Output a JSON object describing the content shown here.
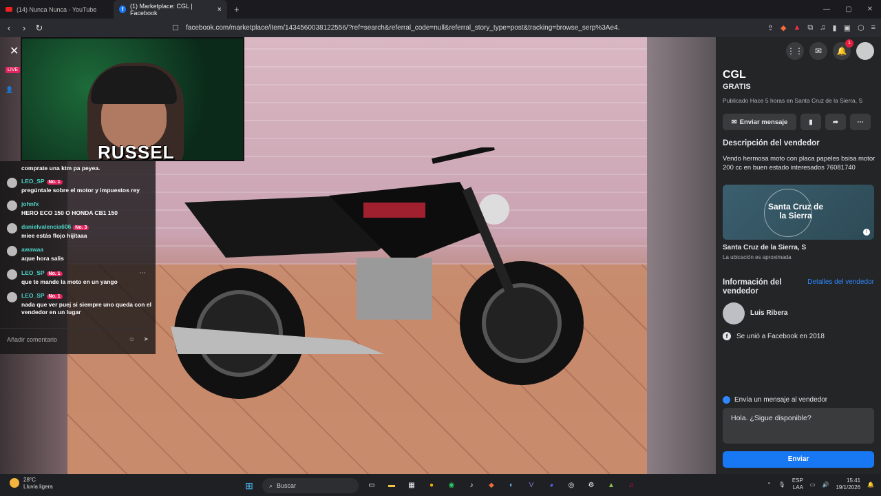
{
  "tabs": [
    {
      "title": "(14) Nunca Nunca - YouTube",
      "icon": "youtube-icon"
    },
    {
      "title": "(1) Marketplace: CGL | Facebook",
      "icon": "facebook-icon"
    }
  ],
  "address": {
    "url": "facebook.com/marketplace/item/1434560038122556/?ref=search&referral_code=null&referral_story_type=post&tracking=browse_serp%3Ae4..."
  },
  "stream": {
    "streamer_name": "RUSSEL",
    "live_label": "LIVE",
    "chat": [
      {
        "user": "",
        "badge": "",
        "text": "comprate una ktm pa peyea."
      },
      {
        "user": "LEO_SP",
        "badge": "No. 1",
        "text": "pregúntale sobre el motor y impuestos rey"
      },
      {
        "user": "johnfx",
        "badge": "",
        "text": "HERO ECO 150 O HONDA CB1 150"
      },
      {
        "user": "danielvalencia606",
        "badge": "No. 3",
        "text": "miee estás flojo hijitaaa"
      },
      {
        "user": "awawaa",
        "badge": "",
        "text": "aque hora salis"
      },
      {
        "user": "LEO_SP",
        "badge": "No. 1",
        "text": "que te mande la moto en un yango"
      },
      {
        "user": "LEO_SP",
        "badge": "No. 1",
        "text": "nada que ver puej si siempre uno queda con el vendedor en un lugar"
      }
    ],
    "comment_placeholder": "Añadir comentario"
  },
  "listing": {
    "title": "CGL",
    "price": "GRATIS",
    "posted": "Publicado Hace 5 horas en Santa Cruz de la Sierra, S",
    "send_message_label": "Enviar mensaje",
    "seller_desc_heading": "Descripción del vendedor",
    "description": "Vendo hermosa moto con placa papeles bsisa motor 200 cc en buen estado interesados 76081740",
    "map_label": "Santa Cruz de la Sierra",
    "location": "Santa Cruz de la Sierra, S",
    "location_note": "La ubicación es aproximada",
    "seller_info_heading": "Información del vendedor",
    "seller_details_link": "Detalles del vendedor",
    "seller_name": "Luis Ribera",
    "joined": "Se unió a Facebook en 2018",
    "message_heading": "Envía un mensaje al vendedor",
    "message_text": "Hola. ¿Sigue disponible?",
    "send_label": "Enviar"
  },
  "header": {
    "notifications": "1"
  },
  "taskbar": {
    "temp": "28°C",
    "weather": "Lluvia ligera",
    "search_label": "Buscar",
    "lang1": "ESP",
    "lang2": "LAA",
    "time": "15:41",
    "date": "19/1/2026"
  }
}
